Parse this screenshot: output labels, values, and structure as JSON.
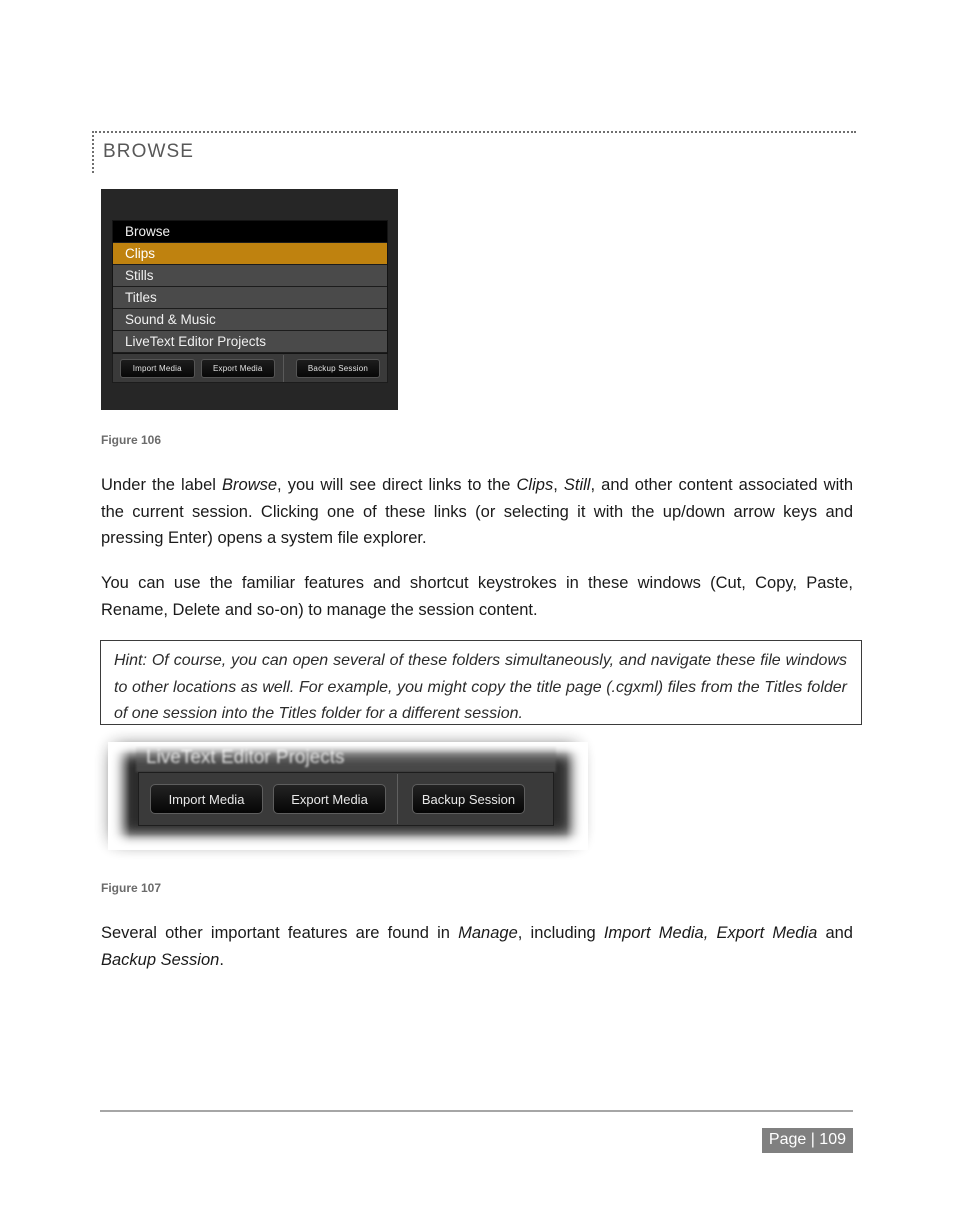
{
  "heading": {
    "text": "BROWSE"
  },
  "figure106": {
    "caption": "Figure 106",
    "menu": [
      {
        "label": "Browse",
        "state": "header"
      },
      {
        "label": "Clips",
        "state": "selected"
      },
      {
        "label": "Stills",
        "state": "normal"
      },
      {
        "label": "Titles",
        "state": "normal"
      },
      {
        "label": "Sound & Music",
        "state": "normal"
      },
      {
        "label": "LiveText Editor Projects",
        "state": "normal"
      }
    ],
    "buttons": {
      "import_media": "Import Media",
      "export_media": "Export Media",
      "backup_session": "Backup Session"
    },
    "colors": {
      "panel_background": "#262626",
      "row_background": "#4a4a4a",
      "header_row_background": "#000000",
      "selected_row_background": "#bf820f",
      "button_bar_background": "#3a3a3a"
    }
  },
  "figure107": {
    "caption": "Figure 107",
    "title_strip": "LiveText Editor Projects",
    "buttons": {
      "import_media": "Import Media",
      "export_media": "Export Media",
      "backup_session": "Backup Session"
    }
  },
  "paragraphs": {
    "p1": {
      "seg1": "Under the label ",
      "em1": "Browse",
      "seg2": ", you will see direct links to the ",
      "em2": "Clips",
      "seg3": ", ",
      "em3": "Still",
      "seg4": ", and other content associated with the current session. Clicking one of these links (or selecting it with the up/down arrow keys and pressing Enter) opens a system file explorer."
    },
    "p2": {
      "text": "You can use the familiar features and shortcut keystrokes in these windows (Cut, Copy, Paste, Rename, Delete and so-on) to manage the session content."
    },
    "p3": {
      "seg1": "Several other important features are found in ",
      "em1": "Manage",
      "seg2": ", including ",
      "em2": "Import Media, Export Media",
      "seg3": " and ",
      "em3": "Backup Session",
      "seg4": "."
    }
  },
  "hint": {
    "text": "Hint: Of course, you can open several of these folders simultaneously, and navigate these file windows to other locations as well. For example, you might copy the title page (.cgxml) files from the Titles folder of one session into the Titles folder for a different session."
  },
  "footer": {
    "page_label": "Page | 109"
  }
}
